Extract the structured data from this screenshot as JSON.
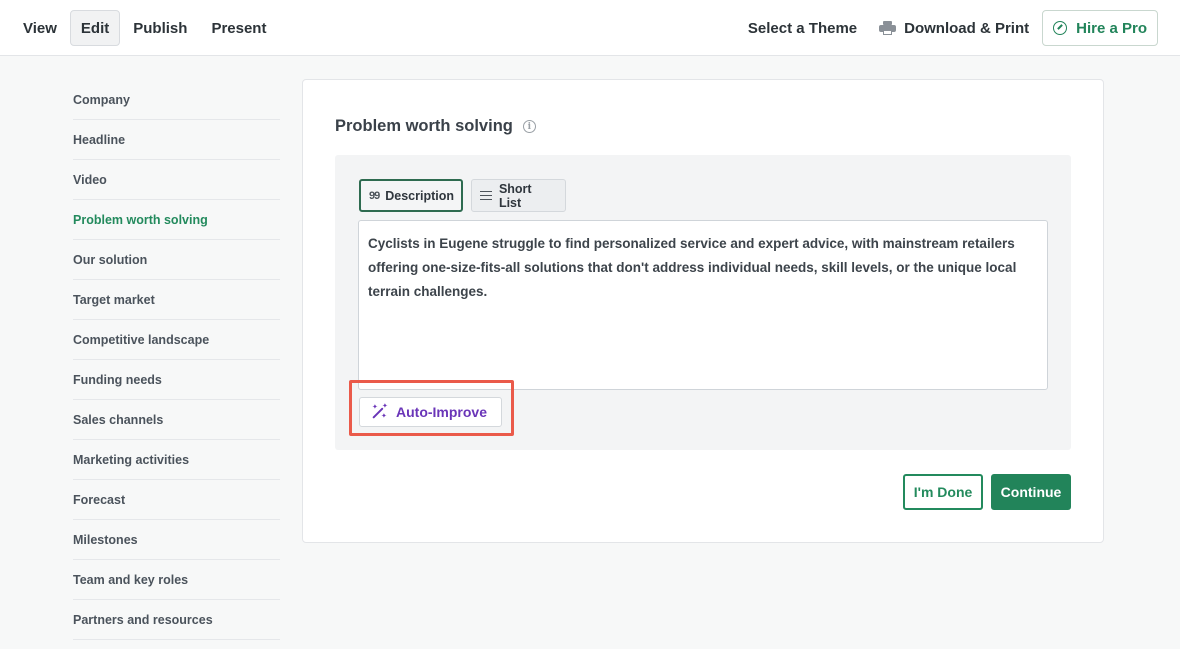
{
  "topnav": {
    "tabs": [
      {
        "label": "View"
      },
      {
        "label": "Edit",
        "active": true
      },
      {
        "label": "Publish"
      },
      {
        "label": "Present"
      }
    ],
    "select_theme": "Select a Theme",
    "download_print": "Download & Print",
    "hire_pro": "Hire a Pro"
  },
  "sidebar": {
    "items": [
      {
        "label": "Company"
      },
      {
        "label": "Headline"
      },
      {
        "label": "Video"
      },
      {
        "label": "Problem worth solving",
        "active": true
      },
      {
        "label": "Our solution"
      },
      {
        "label": "Target market"
      },
      {
        "label": "Competitive landscape"
      },
      {
        "label": "Funding needs"
      },
      {
        "label": "Sales channels"
      },
      {
        "label": "Marketing activities"
      },
      {
        "label": "Forecast"
      },
      {
        "label": "Milestones"
      },
      {
        "label": "Team and key roles"
      },
      {
        "label": "Partners and resources"
      }
    ]
  },
  "editor": {
    "title": "Problem worth solving",
    "modes": {
      "description": "Description",
      "short_list": "Short List",
      "selected": "description"
    },
    "text": "Cyclists in Eugene struggle to find personalized service and expert advice, with mainstream retailers offering one-size-fits-all solutions that don't address individual needs, skill levels, or the unique local terrain challenges.",
    "auto_improve": "Auto-Improve",
    "done_label": "I'm Done",
    "continue_label": "Continue"
  },
  "colors": {
    "accent_green": "#22845a",
    "auto_improve_purple": "#6a35b8",
    "highlight_red": "#ea5a4a"
  }
}
